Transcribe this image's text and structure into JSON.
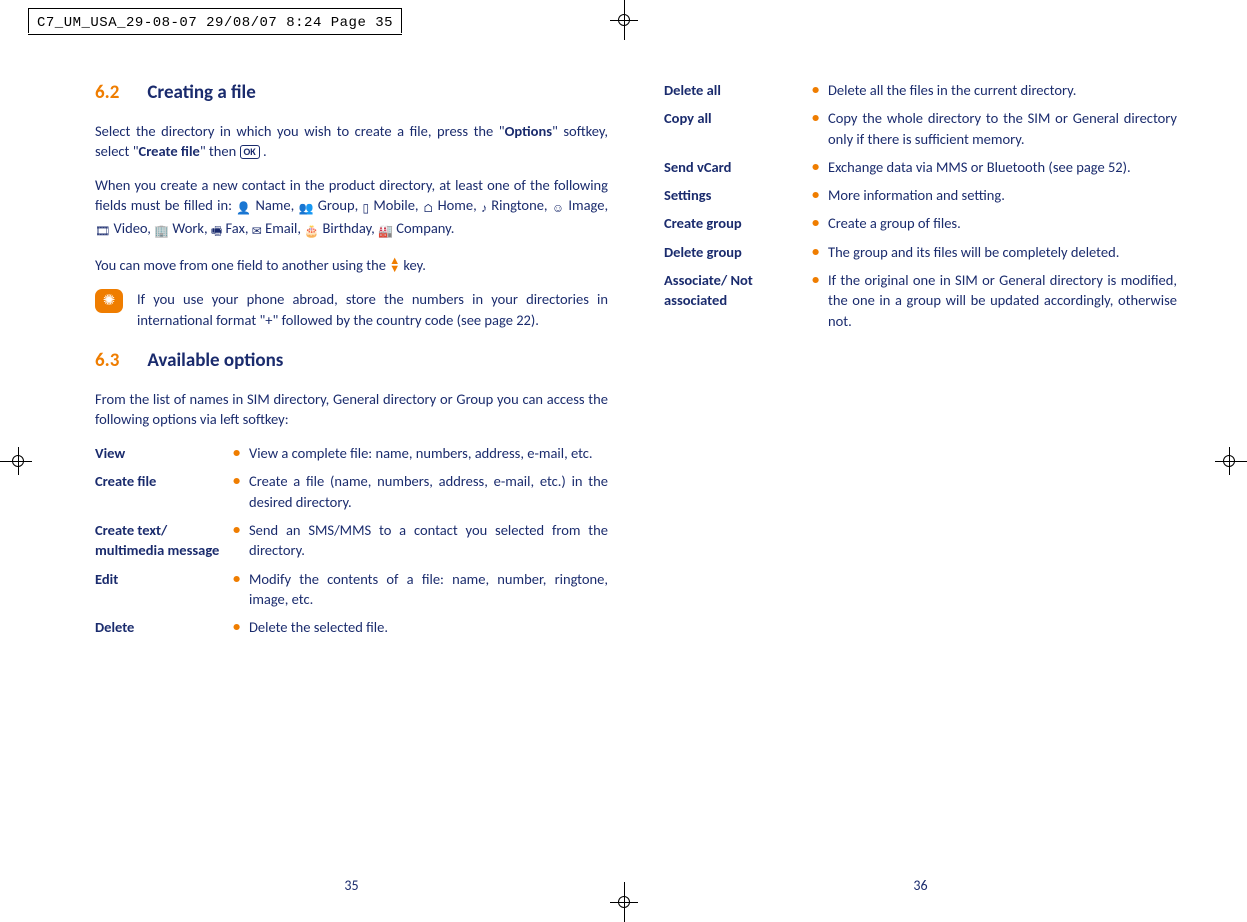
{
  "print_info": "C7_UM_USA_29-08-07  29/08/07  8:24  Page 35",
  "left": {
    "s62_num": "6.2",
    "s62_title": "Creating a file",
    "s62_p1a": "Select the directory in which you wish to create a file, press the \"",
    "s62_p1b": "Options",
    "s62_p1c": "\" softkey, select \"",
    "s62_p1d": "Create file",
    "s62_p1e": "\" then ",
    "s62_ok": "OK",
    "s62_p1f": " .",
    "s62_p2_lead": "When you create a new contact in the product directory, at least one of the following fields must be filled in: ",
    "fields": {
      "name": "Name,",
      "group": "Group,",
      "mobile": "Mobile,",
      "home": "Home,",
      "ringtone": "Ringtone,",
      "image": "Image,",
      "video": "Video,",
      "work": "Work,",
      "fax": "Fax,",
      "email": "Email,",
      "birthday": "Birthday,",
      "company": "Company."
    },
    "s62_p3a": "You can move from one field to another using the ",
    "s62_p3b": " key.",
    "tip": "If you use your phone abroad, store the numbers in your directories in international format \"+\" followed by the country code (see page 22).",
    "s63_num": "6.3",
    "s63_title": "Available options",
    "s63_p1": "From the list of names in SIM directory, General directory or Group you can access the following options via left softkey:",
    "opts": [
      {
        "label": "View",
        "desc": "View a complete file: name, numbers, address, e-mail, etc."
      },
      {
        "label": "Create file",
        "desc": "Create a file (name, numbers, address, e-mail, etc.) in the desired directory."
      },
      {
        "label": "Create text/ multimedia message",
        "desc": "Send an SMS/MMS to a contact you selected from the directory."
      },
      {
        "label": "Edit",
        "desc": "Modify the contents of a file: name, number, ringtone, image, etc."
      },
      {
        "label": "Delete",
        "desc": "Delete the selected file."
      }
    ],
    "page_num": "35"
  },
  "right": {
    "opts": [
      {
        "label": "Delete all",
        "desc": "Delete all the files in the current directory."
      },
      {
        "label": "Copy all",
        "desc": "Copy the whole directory to the SIM or General directory only if there is sufficient memory."
      },
      {
        "label": "Send vCard",
        "desc": "Exchange data via MMS or Bluetooth (see page 52)."
      },
      {
        "label": "Settings",
        "desc": "More information and setting."
      },
      {
        "label": "Create group",
        "desc": "Create a group of files."
      },
      {
        "label": "Delete group",
        "desc": "The group and its files will be completely deleted."
      },
      {
        "label": "Associate/ Not associated",
        "desc": "If the original one in SIM or General directory is modified, the one in a group will be updated accordingly, otherwise not."
      }
    ],
    "page_num": "36"
  }
}
